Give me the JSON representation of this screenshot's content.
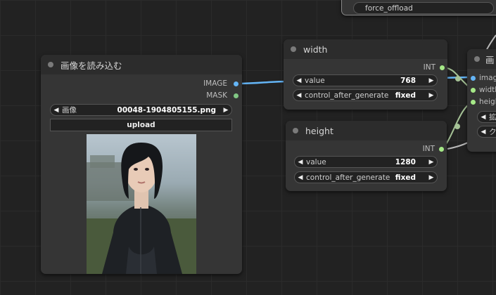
{
  "top_node": {
    "widget_label": "force_offload"
  },
  "load_image_node": {
    "title": "画像を読み込む",
    "outputs": [
      {
        "label": "IMAGE"
      },
      {
        "label": "MASK"
      }
    ],
    "image_widget": {
      "label": "画像",
      "value": "00048-1904805155.png"
    },
    "upload_label": "upload"
  },
  "width_node": {
    "title": "width",
    "output_label": "INT",
    "value_widget": {
      "label": "value",
      "value": "768"
    },
    "control_widget": {
      "label": "control_after_generate",
      "value": "fixed"
    }
  },
  "height_node": {
    "title": "height",
    "output_label": "INT",
    "value_widget": {
      "label": "value",
      "value": "1280"
    },
    "control_widget": {
      "label": "control_after_generate",
      "value": "fixed"
    }
  },
  "right_node": {
    "title": "画",
    "inputs": [
      {
        "label": "imag"
      },
      {
        "label": "width"
      },
      {
        "label": "heigh"
      }
    ],
    "widgets": [
      {
        "label": "拡"
      },
      {
        "label": "ク"
      }
    ]
  },
  "colors": {
    "image_wire": "#64b5f6",
    "int_wire": "#a5c296",
    "canvas": "#222222",
    "node_bg": "#353535"
  },
  "icons": [
    "arrow-left-icon",
    "arrow-right-icon",
    "node-dot-icon"
  ]
}
